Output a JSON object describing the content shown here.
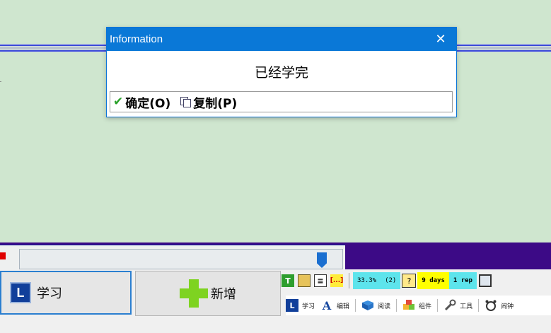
{
  "dialog": {
    "title": "Information",
    "close_glyph": "✕",
    "message": "已经学完",
    "ok_label": "确定(O)",
    "copy_label": "复制(P)"
  },
  "main_buttons": {
    "learn_label": "学习",
    "learn_icon_letter": "L",
    "add_label": "新增"
  },
  "stats": {
    "percent": "33.3%",
    "count": "(2)",
    "days": "9 days",
    "rep": "1 rep"
  },
  "tabs": [
    {
      "label": "学习",
      "icon": "L"
    },
    {
      "label": "编辑",
      "icon": "A"
    },
    {
      "label": "阅读",
      "icon": "book-icon"
    },
    {
      "label": "组件",
      "icon": "cubes-icon"
    },
    {
      "label": "工具",
      "icon": "wrench-icon"
    },
    {
      "label": "闹钟",
      "icon": "alarm-icon"
    }
  ],
  "slider": {
    "position_fraction": 0.95
  },
  "colors": {
    "titlebar": "#0a78d7",
    "slider_strip": "#3c0a86",
    "background": "#cfe6cf",
    "cyan_stat": "#5de4ec",
    "yellow_stat": "#ffff00"
  }
}
